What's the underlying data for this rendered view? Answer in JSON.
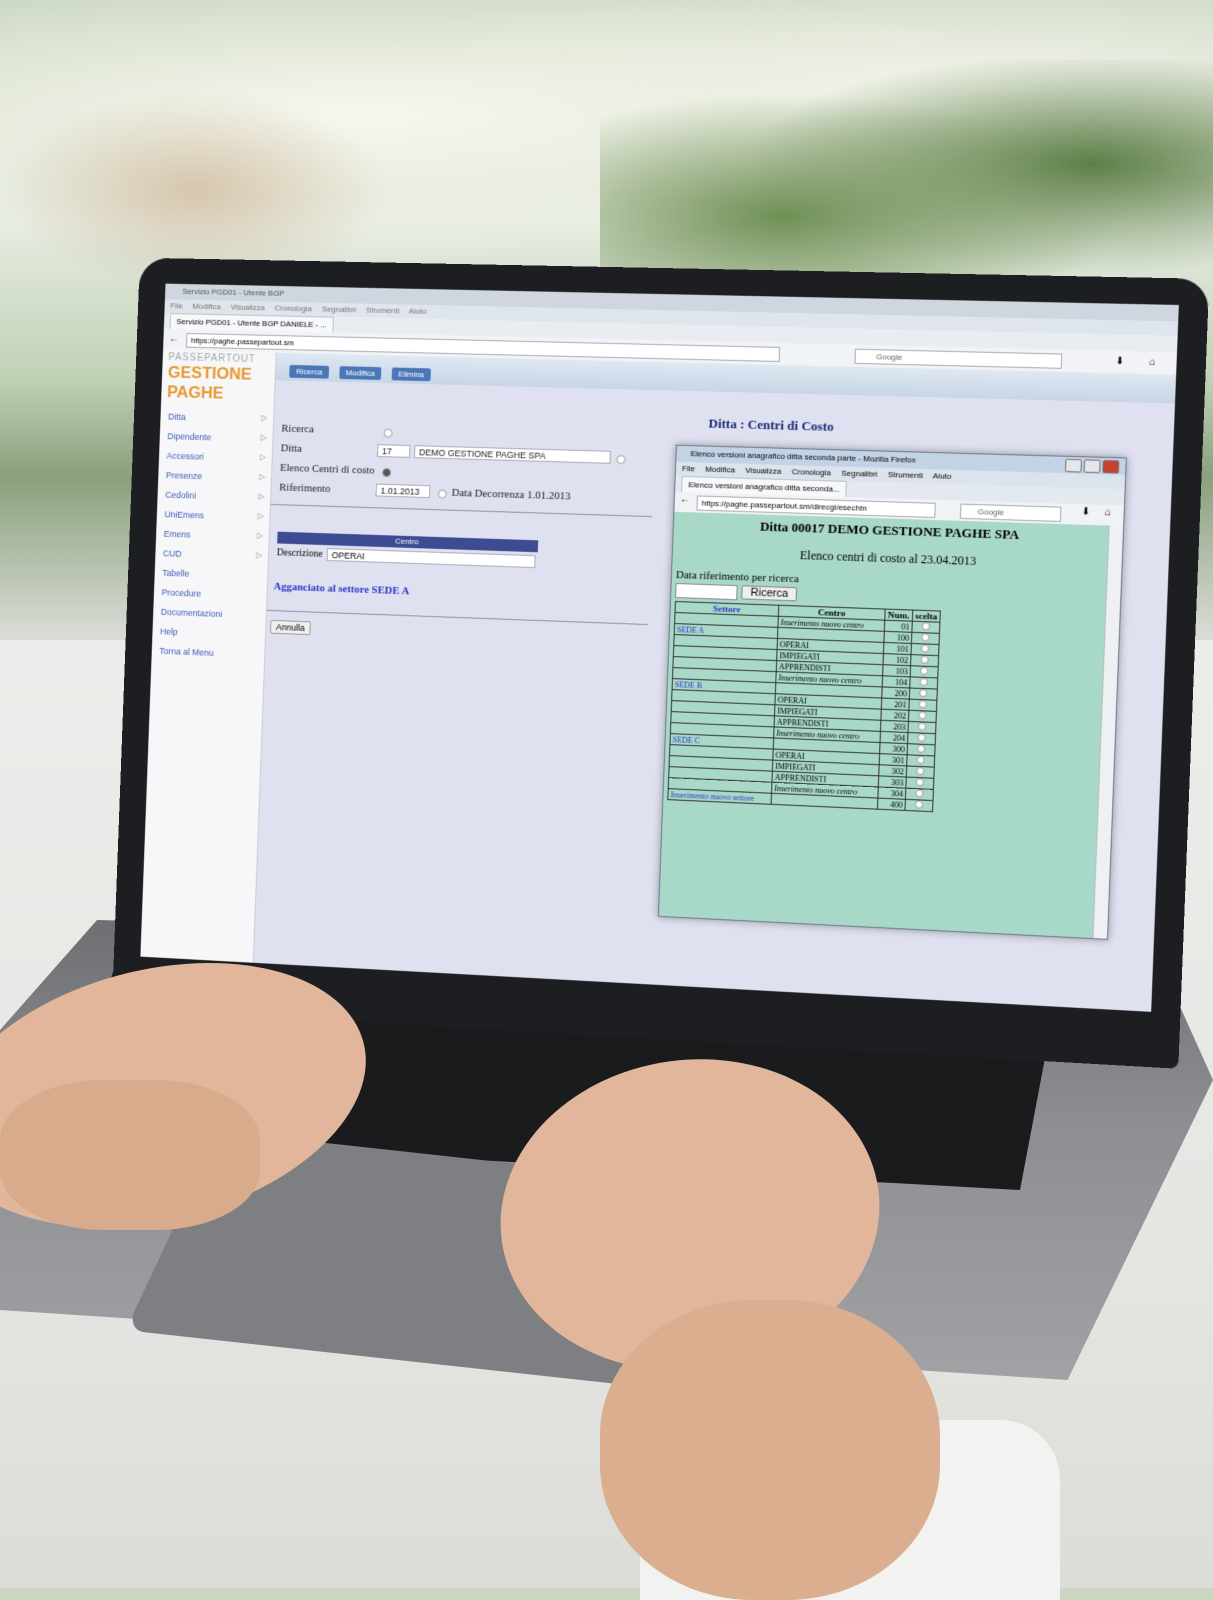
{
  "browser": {
    "window_title": "Servizio PGD01 - Utente BGP",
    "menu": [
      "File",
      "Modifica",
      "Visualizza",
      "Cronologia",
      "Segnalibri",
      "Strumenti",
      "Aiuto"
    ],
    "tab": "Servizio PGD01 - Utente BGP DANIELE - ...",
    "url": "https://paghe.passepartout.sm",
    "search_placeholder": "Google"
  },
  "app": {
    "logo_top": "PASSEPARTOUT",
    "logo_main": "GESTIONE PAGHE",
    "nav": [
      {
        "label": "Ditta",
        "arrow": "▷"
      },
      {
        "label": "Dipendente",
        "arrow": "▷"
      },
      {
        "label": "Accessori",
        "arrow": "▷"
      },
      {
        "label": "Presenze",
        "arrow": "▷"
      },
      {
        "label": "Cedolini",
        "arrow": "▷"
      },
      {
        "label": "UniEmens",
        "arrow": "▷"
      },
      {
        "label": "Emens",
        "arrow": "▷"
      },
      {
        "label": "CUD",
        "arrow": "▷"
      },
      {
        "label": "Tabelle",
        "arrow": ""
      },
      {
        "label": "Procedure",
        "arrow": ""
      },
      {
        "label": "Documentazioni",
        "arrow": ""
      },
      {
        "label": "Help",
        "arrow": ""
      },
      {
        "label": "Torna al Menu",
        "arrow": ""
      }
    ],
    "toolbar": {
      "ricerca": "Ricerca",
      "modifica": "Modifica",
      "elimina": "Elimina"
    },
    "page_title": "Ditta : Centri di Costo",
    "form": {
      "ricerca_label": "Ricerca",
      "ditta_label": "Ditta",
      "ditta_code": "17",
      "ditta_name": "DEMO GESTIONE PAGHE SPA",
      "elenco_label": "Elenco Centri di costo",
      "riferimento_label": "Riferimento",
      "riferimento_value": "1.01.2013",
      "decorrenza_label": "Data Decorrenza 1.01.2013",
      "centro_header": "Centro",
      "descrizione_label": "Descrizione",
      "descrizione_value": "OPERAI",
      "agganciato": "Agganciato al settore SEDE A",
      "annulla": "Annulla"
    }
  },
  "popup": {
    "window_title": "Elenco versioni anagrafico ditta seconda parte - Mozilla Firefox",
    "menu": [
      "File",
      "Modifica",
      "Visualizza",
      "Cronologia",
      "Segnalibri",
      "Strumenti",
      "Aiuto"
    ],
    "tab": "Elenco versioni anagrafico ditta seconda...",
    "url": "https://paghe.passepartout.sm/direcgi/esechtn",
    "search_placeholder": "Google",
    "heading": "Ditta 00017 DEMO GESTIONE PAGHE SPA",
    "subheading": "Elenco centri di costo al 23.04.2013",
    "data_label": "Data riferimento per ricerca",
    "ricerca_button": "Ricerca",
    "columns": [
      "Settore",
      "Centro",
      "Num.",
      "scelta"
    ],
    "rows": [
      {
        "settore": "",
        "centro": "Inserimento nuovo centro",
        "num": "01",
        "ins": true
      },
      {
        "settore": "SEDE A",
        "centro": "",
        "num": "100"
      },
      {
        "settore": "",
        "centro": "OPERAI",
        "num": "101"
      },
      {
        "settore": "",
        "centro": "IMPIEGATI",
        "num": "102"
      },
      {
        "settore": "",
        "centro": "APPRENDISTI",
        "num": "103"
      },
      {
        "settore": "",
        "centro": "Inserimento nuovo centro",
        "num": "104",
        "ins": true
      },
      {
        "settore": "SEDE B",
        "centro": "",
        "num": "200"
      },
      {
        "settore": "",
        "centro": "OPERAI",
        "num": "201"
      },
      {
        "settore": "",
        "centro": "IMPIEGATI",
        "num": "202"
      },
      {
        "settore": "",
        "centro": "APPRENDISTI",
        "num": "203"
      },
      {
        "settore": "",
        "centro": "Inserimento nuovo centro",
        "num": "204",
        "ins": true
      },
      {
        "settore": "SEDE C",
        "centro": "",
        "num": "300"
      },
      {
        "settore": "",
        "centro": "OPERAI",
        "num": "301"
      },
      {
        "settore": "",
        "centro": "IMPIEGATI",
        "num": "302"
      },
      {
        "settore": "",
        "centro": "APPRENDISTI",
        "num": "303"
      },
      {
        "settore": "",
        "centro": "Inserimento nuovo centro",
        "num": "304",
        "ins": true
      },
      {
        "settore": "Inserimento nuovo settore",
        "centro": "",
        "num": "400"
      }
    ]
  }
}
